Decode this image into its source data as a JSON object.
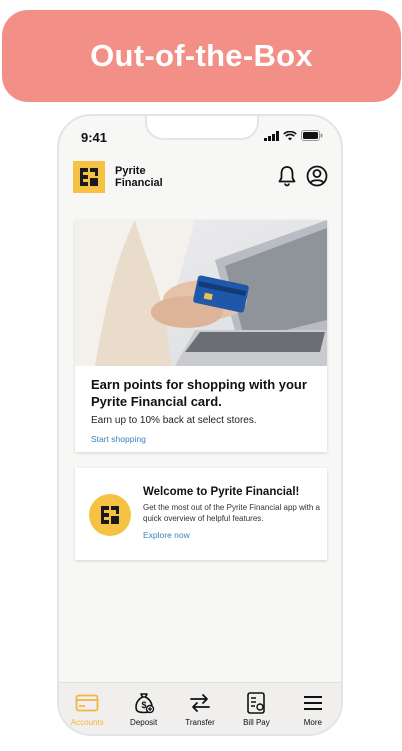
{
  "banner": {
    "text": "Out-of-the-Box"
  },
  "status_bar": {
    "time": "9:41"
  },
  "header": {
    "brand_line1": "Pyrite",
    "brand_line2": "Financial",
    "logo_icon": "pyrite-logo-icon",
    "bell_icon": "bell-icon",
    "profile_icon": "user-circle-icon"
  },
  "promo_card": {
    "title": "Earn points for shopping with your Pyrite Financial card.",
    "subtitle": "Earn up to 10% back at select stores.",
    "link": "Start shopping"
  },
  "welcome_card": {
    "title": "Welcome to Pyrite Financial!",
    "description": "Get the most out of the Pyrite Financial app with a quick overview of helpful features.",
    "link": "Explore now"
  },
  "tabbar": {
    "items": [
      {
        "label": "Accounts",
        "icon": "card-icon",
        "active": true
      },
      {
        "label": "Deposit",
        "icon": "money-bag-icon",
        "active": false
      },
      {
        "label": "Transfer",
        "icon": "transfer-arrows-icon",
        "active": false
      },
      {
        "label": "Bill Pay",
        "icon": "bill-icon",
        "active": false
      },
      {
        "label": "More",
        "icon": "menu-icon",
        "active": false
      }
    ]
  },
  "colors": {
    "banner": "#f28f86",
    "brand_yellow": "#f6c244",
    "link_blue": "#3b82c4",
    "active_tab": "#f3b53a"
  }
}
